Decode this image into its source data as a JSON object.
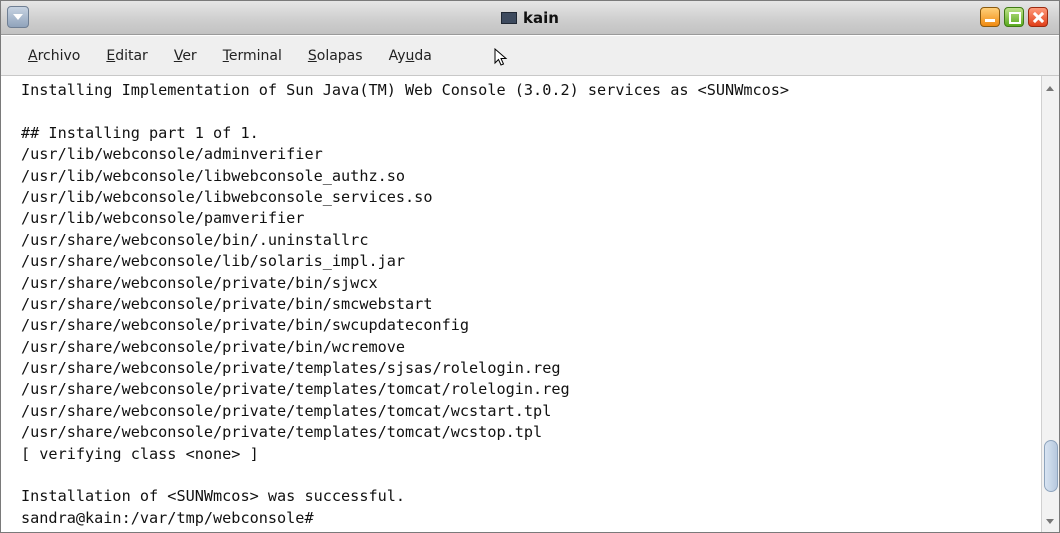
{
  "window": {
    "title": "kain"
  },
  "menubar": {
    "items": [
      {
        "pre": "",
        "mnemonic": "A",
        "post": "rchivo"
      },
      {
        "pre": "",
        "mnemonic": "E",
        "post": "ditar"
      },
      {
        "pre": "",
        "mnemonic": "V",
        "post": "er"
      },
      {
        "pre": "",
        "mnemonic": "T",
        "post": "erminal"
      },
      {
        "pre": "",
        "mnemonic": "S",
        "post": "olapas"
      },
      {
        "pre": "Ay",
        "mnemonic": "u",
        "post": "da"
      }
    ]
  },
  "terminal": {
    "lines": [
      "Installing Implementation of Sun Java(TM) Web Console (3.0.2) services as <SUNWmcos>",
      "",
      "## Installing part 1 of 1.",
      "/usr/lib/webconsole/adminverifier",
      "/usr/lib/webconsole/libwebconsole_authz.so",
      "/usr/lib/webconsole/libwebconsole_services.so",
      "/usr/lib/webconsole/pamverifier",
      "/usr/share/webconsole/bin/.uninstallrc",
      "/usr/share/webconsole/lib/solaris_impl.jar",
      "/usr/share/webconsole/private/bin/sjwcx",
      "/usr/share/webconsole/private/bin/smcwebstart",
      "/usr/share/webconsole/private/bin/swcupdateconfig",
      "/usr/share/webconsole/private/bin/wcremove",
      "/usr/share/webconsole/private/templates/sjsas/rolelogin.reg",
      "/usr/share/webconsole/private/templates/tomcat/rolelogin.reg",
      "/usr/share/webconsole/private/templates/tomcat/wcstart.tpl",
      "/usr/share/webconsole/private/templates/tomcat/wcstop.tpl",
      "[ verifying class <none> ]",
      "",
      "Installation of <SUNWmcos> was successful.",
      "sandra@kain:/var/tmp/webconsole# "
    ]
  },
  "scrollbar": {
    "position": 0.95
  }
}
